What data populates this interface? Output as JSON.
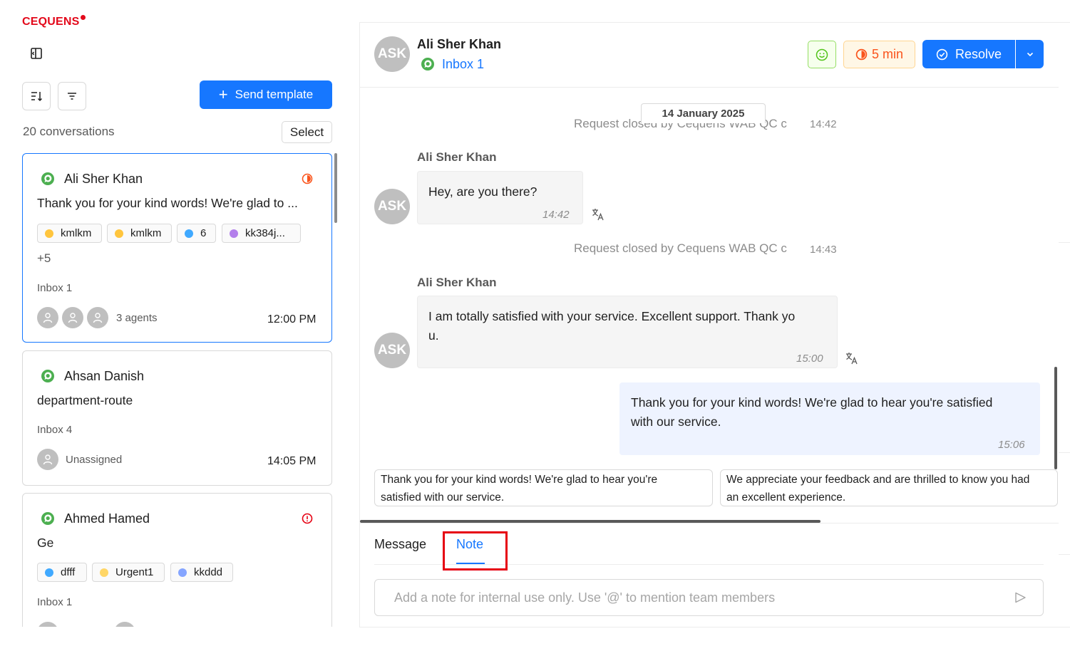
{
  "brand": {
    "logo_text": "CEQUENS",
    "color": "#e3091b"
  },
  "toolbar": {
    "sort_icon": "sort-descending-icon",
    "filter_icon": "filter-icon",
    "send_template_label": "Send template"
  },
  "list_header": {
    "count_text": "20 conversations",
    "select_label": "Select"
  },
  "conversations": [
    {
      "name": "Ali Sher Khan",
      "message": "Thank you for your kind words! We're glad to ...",
      "status_icon": "half-circle-timer-icon",
      "tags": [
        {
          "label": "kmlkm",
          "color": "#ffc53d"
        },
        {
          "label": "kmlkm",
          "color": "#ffc53d"
        },
        {
          "label": "6",
          "color": "#40a9ff"
        },
        {
          "label": "kk384j...",
          "color": "#b37feb"
        }
      ],
      "more_tags": "+5",
      "inbox": "Inbox 1",
      "agents": "3 agents",
      "time": "12:00 PM"
    },
    {
      "name": "Ahsan Danish",
      "message": "department-route",
      "inbox": "Inbox 4",
      "agents": "Unassigned",
      "time": "14:05 PM"
    },
    {
      "name": "Ahmed Hamed",
      "message": "Ge",
      "status_icon": "alert-circle-icon",
      "tags": [
        {
          "label": "dfff",
          "color": "#40a9ff"
        },
        {
          "label": "Urgent1",
          "color": "#ffd666"
        },
        {
          "label": "kkddd",
          "color": "#85a5ff"
        }
      ],
      "inbox": "Inbox 1"
    }
  ],
  "chat_header": {
    "avatar_initials": "ASK",
    "name": "Ali Sher Khan",
    "inbox": "Inbox 1",
    "timer": "5 min",
    "resolve_label": "Resolve"
  },
  "chat": {
    "date_label": "14 January 2025",
    "system_1": {
      "text": "Request closed by Cequens WAB QC c",
      "time": "14:42"
    },
    "msg_1": {
      "sender": "Ali Sher Khan",
      "text": "Hey, are you there?",
      "time": "14:42"
    },
    "system_2": {
      "text": "Request closed by Cequens WAB QC c",
      "time": "14:43"
    },
    "msg_2": {
      "sender": "Ali Sher Khan",
      "line1": "I am totally satisfied with your service. Excellent support. Thank yo",
      "line2": "u.",
      "time": "15:00"
    },
    "msg_3": {
      "line1": "Thank you for your kind words! We're glad to hear you're satisfied",
      "line2": "with our service.",
      "time": "15:06"
    }
  },
  "suggestions": [
    {
      "line1": "Thank you for your kind words! We're glad to hear you're",
      "line2": "satisfied with our service."
    },
    {
      "line1": "We appreciate your feedback and are thrilled to know you had",
      "line2": "an excellent experience."
    }
  ],
  "composer": {
    "tab_message": "Message",
    "tab_note": "Note",
    "active_tab": "Note",
    "placeholder": "Add a note for internal use only. Use '@' to mention team members"
  },
  "colors": {
    "primary": "#1677ff",
    "whatsapp": "#4caf50",
    "highlight": "#e60012",
    "timer": "#fa541c"
  }
}
